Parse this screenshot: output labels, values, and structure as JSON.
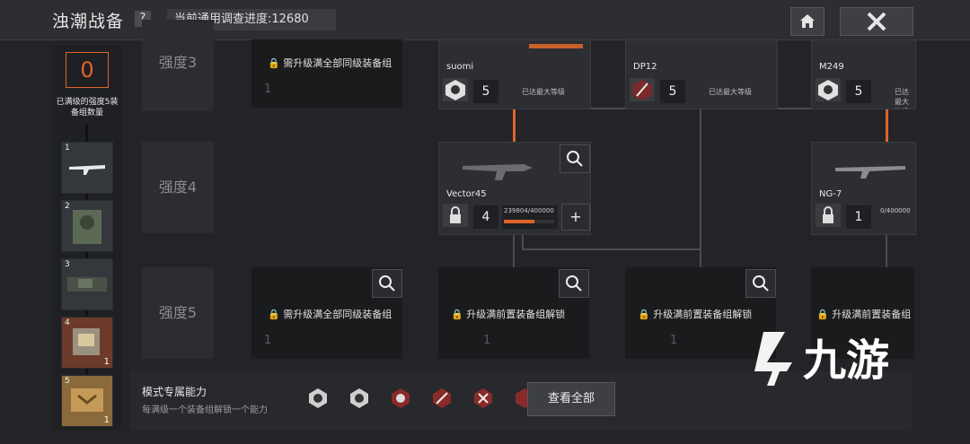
{
  "header": {
    "title": "浊潮战备",
    "help": "?",
    "progress_label": "当前通用调查进度:12680"
  },
  "sidebar": {
    "counter": "0",
    "counter_label": "已满级的强度5装备组数量",
    "slots": [
      {
        "num": "1",
        "count": ""
      },
      {
        "num": "2",
        "count": ""
      },
      {
        "num": "3",
        "count": ""
      },
      {
        "num": "4",
        "count": "1"
      },
      {
        "num": "5",
        "count": "1"
      }
    ]
  },
  "rows": [
    {
      "label": "强度3"
    },
    {
      "label": "强度4"
    },
    {
      "label": "强度5"
    }
  ],
  "cards": {
    "row3_locked": "需升级满全部同级装备组",
    "suomi": {
      "name": "suomi",
      "level": "5",
      "status": "已达最大等级"
    },
    "dp12": {
      "name": "DP12",
      "level": "5",
      "status": "已达最大等级"
    },
    "m249": {
      "name": "M249",
      "level": "5",
      "status": "已达最大等级"
    },
    "vector45": {
      "name": "Vector45",
      "level": "4",
      "exp": "239804/400000",
      "progress": 0.6
    },
    "ng7": {
      "name": "NG-7",
      "level": "1",
      "exp": "0/400000"
    },
    "row5_locked": "需升级满全部同级装备组",
    "row5_unlock1": "升级满前置装备组解锁",
    "row5_unlock2": "升级满前置装备组解锁",
    "row5_unlock3": "升级满前置装备组",
    "row5_level": "1"
  },
  "footer": {
    "title": "模式专属能力",
    "subtitle": "每满级一个装备组解锁一个能力",
    "view_all": "查看全部"
  },
  "watermark": {
    "text": "九游"
  },
  "colors": {
    "accent": "#e0632a",
    "bg": "#222427"
  }
}
